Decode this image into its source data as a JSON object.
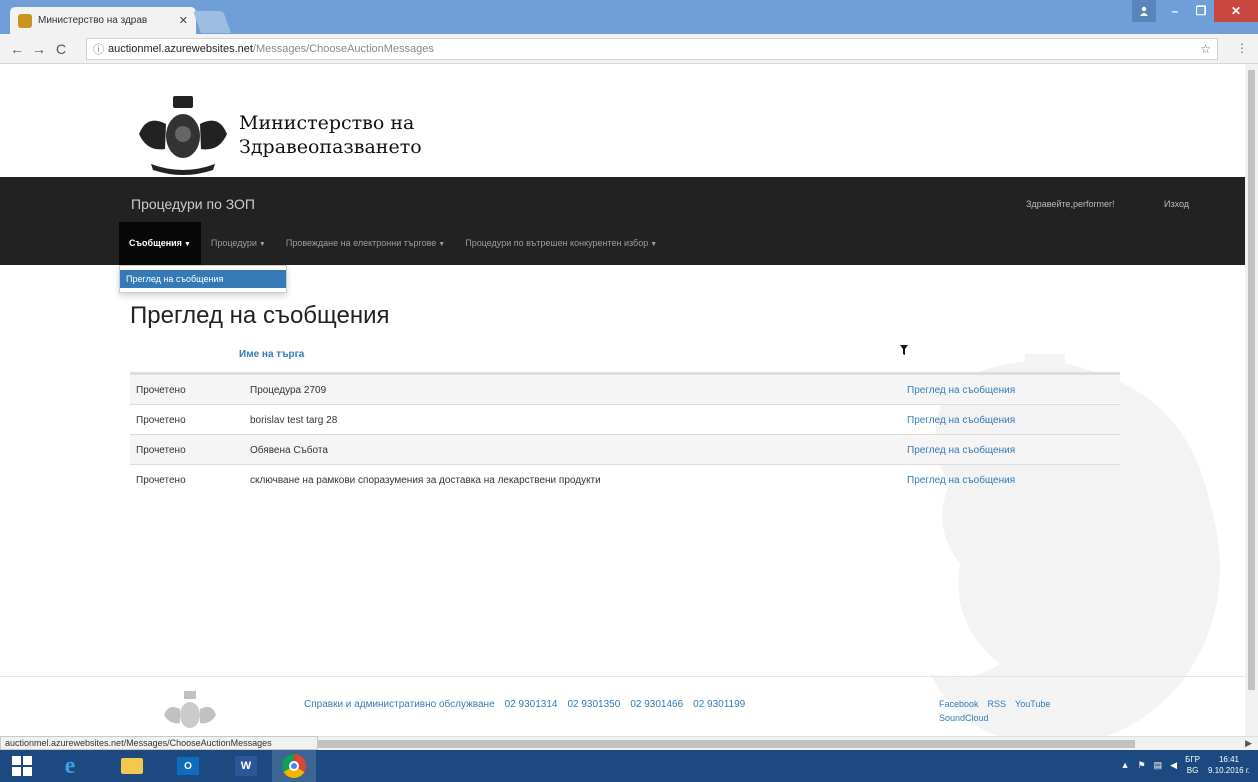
{
  "browser": {
    "tab_title": "Министерство на здрав",
    "tab_close": "✕",
    "url_host": "auctionmel.azurewebsites.net",
    "url_path": "/Messages/ChooseAuctionMessages",
    "window_close": "✕",
    "window_min": "–",
    "window_max": "❐",
    "back": "←",
    "forward": "→",
    "reload": "C",
    "star": "☆",
    "menu": "⋮",
    "status_url": "auctionmel.azurewebsites.net/Messages/ChooseAuctionMessages"
  },
  "header": {
    "ministry_line1": "Министерство на",
    "ministry_line2": "Здравеопазването"
  },
  "navbar": {
    "brand": "Процедури по ЗОП",
    "greeting": "Здравейте,performer!",
    "logout": "Изход",
    "items": [
      {
        "label": "Съобщения"
      },
      {
        "label": "Процедури"
      },
      {
        "label": "Провеждане на електронни търгове"
      },
      {
        "label": "Процедури по вътрешен конкурентен избор"
      }
    ]
  },
  "dropdown": {
    "item": "Преглед на съобщения"
  },
  "main": {
    "title": "Преглед на съобщения",
    "column_name": "Име на търга",
    "rows": [
      {
        "status": "Прочетено",
        "name": "Процедура 2709",
        "link": "Преглед на съобщения"
      },
      {
        "status": "Прочетено",
        "name": "borislav test targ 28",
        "link": "Преглед на съобщения"
      },
      {
        "status": "Прочетено",
        "name": "Обявена Събота",
        "link": "Преглед на съобщения"
      },
      {
        "status": "Прочетено",
        "name": "сключване на рамкови споразумения за доставка на лекарствени продукти",
        "link": "Преглед на съобщения"
      }
    ]
  },
  "footer": {
    "service": "Справки и административно обслужване",
    "phones": [
      "02 9301314",
      "02 9301350",
      "02 9301466",
      "02 9301199"
    ],
    "social": [
      "Facebook",
      "RSS",
      "YouTube"
    ],
    "soundcloud": "SoundCloud"
  },
  "taskbar": {
    "outlook": "O",
    "word": "W",
    "lang_top": "БГР",
    "lang_bottom": "BG",
    "time": "16:41",
    "date": "9.10.2016 г."
  },
  "colors": {
    "link": "#337ab7",
    "navbar": "#222222",
    "taskbar": "#1c4a80",
    "chrome_frame": "#6f9fd6"
  }
}
